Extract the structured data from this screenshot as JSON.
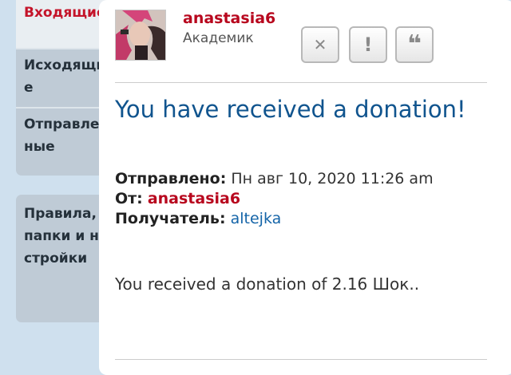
{
  "nav": {
    "inbox": "Входящие",
    "outbox": "Исходящие",
    "sent": "Отправленные",
    "rules": "Правила, папки и настройки"
  },
  "post": {
    "author": "anastasia6",
    "rank": "Академик",
    "title": "You have received a donation!",
    "sent_label": "Отправлено:",
    "sent_value": "Пн авг 10, 2020 11:26 am",
    "from_label": "От:",
    "from_value": "anastasia6",
    "to_label": "Получатель:",
    "to_value": "altejka",
    "body": "You received a donation of 2.16 Шок.."
  },
  "buttons": {
    "delete": "✕",
    "report": "!",
    "quote": "❝"
  },
  "icons": [
    "close-icon",
    "exclamation-icon",
    "quote-icon"
  ]
}
